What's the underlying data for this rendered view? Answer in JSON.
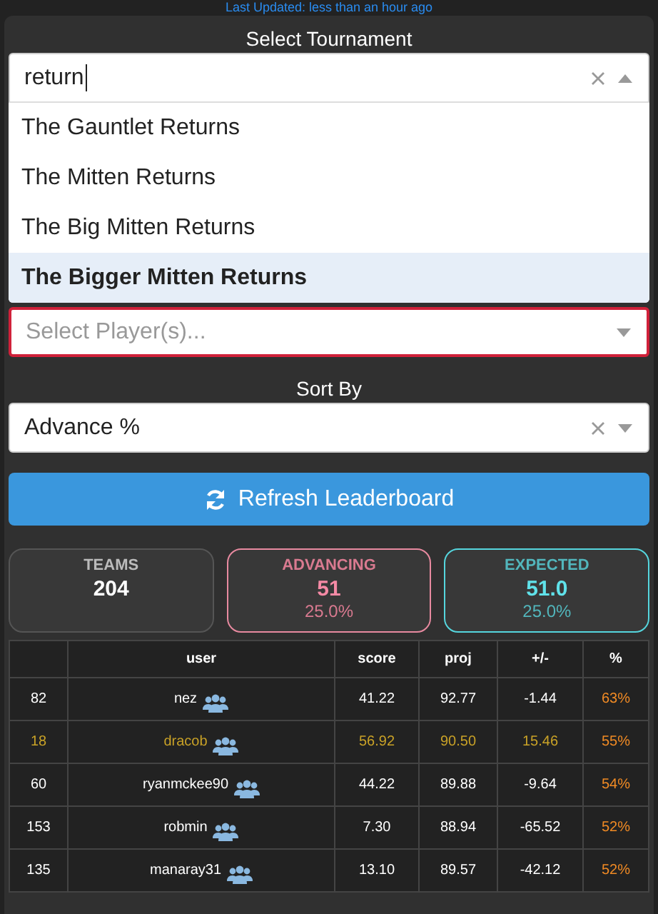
{
  "last_updated": "Last Updated: less than an hour ago",
  "tournament": {
    "label": "Select Tournament",
    "value": "return",
    "open": true,
    "options": [
      {
        "label": "The Gauntlet Returns",
        "selected": false
      },
      {
        "label": "The Mitten Returns",
        "selected": false
      },
      {
        "label": "The Big Mitten Returns",
        "selected": false
      },
      {
        "label": "The Bigger Mitten Returns",
        "selected": true
      }
    ]
  },
  "players": {
    "placeholder": "Select Player(s)...",
    "invalid": true
  },
  "sort": {
    "label": "Sort By",
    "value": "Advance %"
  },
  "refresh_button": "Refresh Leaderboard",
  "stats": [
    {
      "kind": "teams",
      "label": "TEAMS",
      "value": "204"
    },
    {
      "kind": "advancing",
      "label": "ADVANCING",
      "value": "51",
      "percent": "25.0%"
    },
    {
      "kind": "expected",
      "label": "EXPECTED",
      "value": "51.0",
      "percent": "25.0%"
    }
  ],
  "table": {
    "columns": [
      "",
      "user",
      "score",
      "proj",
      "+/-",
      "%"
    ],
    "rows": [
      {
        "rank": "82",
        "user": "nez",
        "score": "41.22",
        "proj": "92.77",
        "diff": "-1.44",
        "pct": "63%",
        "highlighted": false
      },
      {
        "rank": "18",
        "user": "dracob",
        "score": "56.92",
        "proj": "90.50",
        "diff": "15.46",
        "pct": "55%",
        "highlighted": true
      },
      {
        "rank": "60",
        "user": "ryanmckee90",
        "score": "44.22",
        "proj": "89.88",
        "diff": "-9.64",
        "pct": "54%",
        "highlighted": false
      },
      {
        "rank": "153",
        "user": "robmin",
        "score": "7.30",
        "proj": "88.94",
        "diff": "-65.52",
        "pct": "52%",
        "highlighted": false
      },
      {
        "rank": "135",
        "user": "manaray31",
        "score": "13.10",
        "proj": "89.57",
        "diff": "-42.12",
        "pct": "52%",
        "highlighted": false
      }
    ]
  }
}
